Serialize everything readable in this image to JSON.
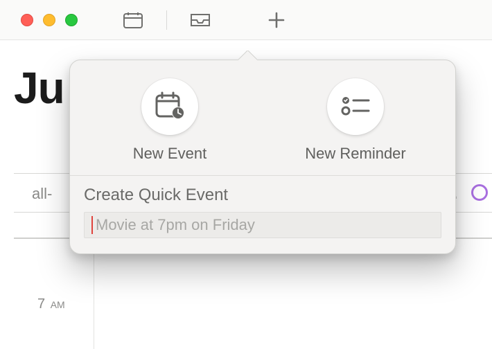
{
  "titlebar": {
    "buttons": {
      "close": "close",
      "minimize": "minimize",
      "maximize": "maximize"
    }
  },
  "toolbar": {
    "calendars_button": "calendars-toggle",
    "inbox_button": "invitations-inbox",
    "add_button": "add"
  },
  "month": {
    "label": "Ju"
  },
  "dayview": {
    "allday_label": "all-",
    "overflow_ellipsis": "...",
    "time_rows": [
      {
        "hour": "7",
        "ampm": "AM"
      }
    ]
  },
  "popover": {
    "new_event_label": "New Event",
    "new_reminder_label": "New Reminder",
    "quick_event_label": "Create Quick Event",
    "quick_event_placeholder": "Movie at 7pm on Friday",
    "quick_event_value": ""
  },
  "icons": {
    "calendar": "calendar-icon",
    "tray": "inbox-icon",
    "plus": "plus-icon",
    "event": "calendar-clock-icon",
    "reminder": "list-bullets-icon"
  },
  "colors": {
    "window_bg": "#ffffff",
    "toolbar_bg": "#fafaf9",
    "popover_bg": "#f4f3f2",
    "muted_text": "#6f6f6d",
    "cursor_red": "#e0433c",
    "ring_purple": "#a96fe0"
  }
}
